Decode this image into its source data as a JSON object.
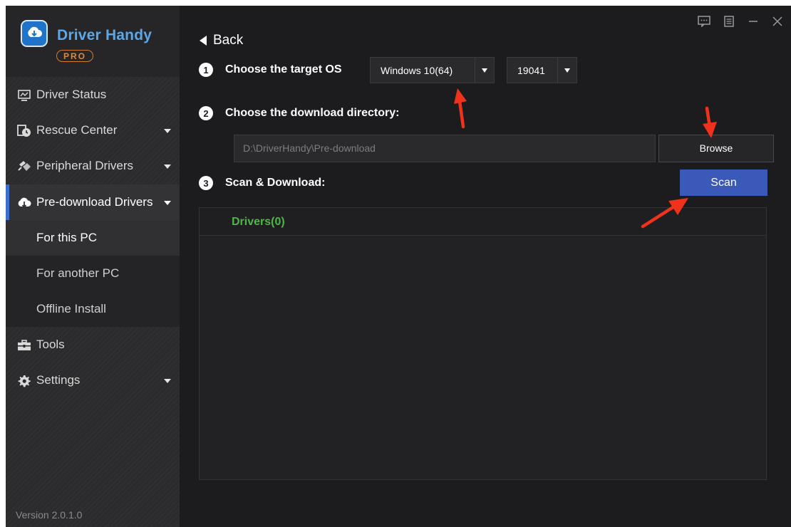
{
  "app": {
    "name": "Driver Handy",
    "edition": "PRO",
    "version": "Version 2.0.1.0"
  },
  "sidebar": {
    "items": [
      {
        "label": "Driver Status",
        "icon": "monitor-icon"
      },
      {
        "label": "Rescue Center",
        "icon": "clock-restore-icon"
      },
      {
        "label": "Peripheral Drivers",
        "icon": "plug-icon"
      },
      {
        "label": "Pre-download Drivers",
        "icon": "cloud-download-icon"
      },
      {
        "label": "Tools",
        "icon": "toolbox-icon"
      },
      {
        "label": "Settings",
        "icon": "gear-icon"
      }
    ],
    "subitems": [
      {
        "label": "For this PC"
      },
      {
        "label": "For another PC"
      },
      {
        "label": "Offline Install"
      }
    ]
  },
  "main": {
    "back_label": "Back",
    "step1": {
      "number": "1",
      "label": "Choose the target OS"
    },
    "os_select": {
      "value": "Windows 10(64)"
    },
    "build_select": {
      "value": "19041"
    },
    "step2": {
      "number": "2",
      "label": "Choose the download directory:"
    },
    "directory": {
      "value": "D:\\DriverHandy\\Pre-download"
    },
    "browse_label": "Browse",
    "step3": {
      "number": "3",
      "label": "Scan & Download:"
    },
    "scan_label": "Scan",
    "drivers_header": "Drivers(0)"
  },
  "colors": {
    "accent": "#3a59b8",
    "drivers_green": "#4fb54a",
    "annotation_red": "#f0321c",
    "logo_blue": "#5aa7ec",
    "pro_orange": "#e0883a"
  }
}
